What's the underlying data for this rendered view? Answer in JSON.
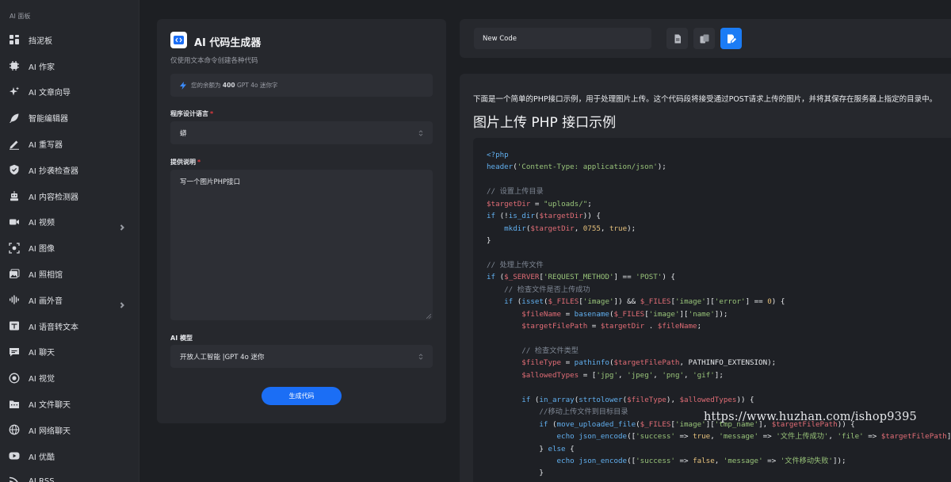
{
  "sidebar": {
    "section_label": "AI 面板",
    "items": [
      {
        "label": "挡泥板",
        "icon": "dashboard-icon"
      },
      {
        "label": "AI 作家",
        "icon": "chip-icon"
      },
      {
        "label": "AI 文章向导",
        "icon": "sparkle-icon"
      },
      {
        "label": "智能编辑器",
        "icon": "feather-icon"
      },
      {
        "label": "AI 重写器",
        "icon": "pencil-icon"
      },
      {
        "label": "AI 抄袭检查器",
        "icon": "shield-check-icon"
      },
      {
        "label": "AI 内容检测器",
        "icon": "robot-icon"
      },
      {
        "label": "AI 视频",
        "icon": "video-icon",
        "expandable": true
      },
      {
        "label": "AI 图像",
        "icon": "image-scan-icon"
      },
      {
        "label": "AI 照相馆",
        "icon": "photo-gallery-icon"
      },
      {
        "label": "AI 画外音",
        "icon": "audio-wave-icon",
        "expandable": true
      },
      {
        "label": "AI 语音转文本",
        "icon": "speech-text-icon"
      },
      {
        "label": "AI 聊天",
        "icon": "chat-icon"
      },
      {
        "label": "AI 视觉",
        "icon": "vision-icon"
      },
      {
        "label": "AI 文件聊天",
        "icon": "folder-chat-icon"
      },
      {
        "label": "AI 网络聊天",
        "icon": "globe-icon"
      },
      {
        "label": "AI 优酷",
        "icon": "youtube-icon"
      },
      {
        "label": "AI RSS",
        "icon": "rss-icon"
      }
    ]
  },
  "form": {
    "title": "AI 代码生成器",
    "subtitle": "仅使用文本命令创建各种代码",
    "balance_prefix": "您的余额为",
    "balance_amount": "400",
    "balance_suffix": "GPT 4o 迷你字",
    "language_label": "程序设计语言",
    "language_value": "蟒",
    "description_label": "提供说明",
    "description_value": "写一个图片PHP接口",
    "model_label": "AI 模型",
    "model_value": "开放人工智能 |GPT 4o 迷你",
    "submit_label": "生成代码"
  },
  "toolbar": {
    "document_name": "New Code"
  },
  "output": {
    "intro": "下面是一个简单的PHP接口示例，用于处理图片上传。这个代码段将接受通过POST请求上传的图片，并将其保存在服务器上指定的目录中。",
    "heading": "图片上传 PHP 接口示例",
    "code_lines": [
      [
        [
          "kw",
          "<?php"
        ]
      ],
      [
        [
          "kw",
          "header"
        ],
        [
          "pl",
          "("
        ],
        [
          "str",
          "'Content-Type: application/json'"
        ],
        [
          "pl",
          ");"
        ]
      ],
      [],
      [
        [
          "com",
          "// 设置上传目录"
        ]
      ],
      [
        [
          "var",
          "$targetDir"
        ],
        [
          "pl",
          " = "
        ],
        [
          "str",
          "\"uploads/\""
        ],
        [
          "pl",
          ";"
        ]
      ],
      [
        [
          "kw",
          "if"
        ],
        [
          "pl",
          " (!"
        ],
        [
          "kw",
          "is_dir"
        ],
        [
          "pl",
          "("
        ],
        [
          "var",
          "$targetDir"
        ],
        [
          "pl",
          ")) {"
        ]
      ],
      [
        [
          "pl",
          "    "
        ],
        [
          "kw",
          "mkdir"
        ],
        [
          "pl",
          "("
        ],
        [
          "var",
          "$targetDir"
        ],
        [
          "pl",
          ", "
        ],
        [
          "num",
          "0755"
        ],
        [
          "pl",
          ", "
        ],
        [
          "num",
          "true"
        ],
        [
          "pl",
          ");"
        ]
      ],
      [
        [
          "pl",
          "}"
        ]
      ],
      [],
      [
        [
          "com",
          "// 处理上传文件"
        ]
      ],
      [
        [
          "kw",
          "if"
        ],
        [
          "pl",
          " ("
        ],
        [
          "var",
          "$_SERVER"
        ],
        [
          "pl",
          "["
        ],
        [
          "str",
          "'REQUEST_METHOD'"
        ],
        [
          "pl",
          "] == "
        ],
        [
          "str",
          "'POST'"
        ],
        [
          "pl",
          ") {"
        ]
      ],
      [
        [
          "pl",
          "    "
        ],
        [
          "com",
          "// 检查文件是否上传成功"
        ]
      ],
      [
        [
          "pl",
          "    "
        ],
        [
          "kw",
          "if"
        ],
        [
          "pl",
          " ("
        ],
        [
          "kw",
          "isset"
        ],
        [
          "pl",
          "("
        ],
        [
          "var",
          "$_FILES"
        ],
        [
          "pl",
          "["
        ],
        [
          "str",
          "'image'"
        ],
        [
          "pl",
          "]) && "
        ],
        [
          "var",
          "$_FILES"
        ],
        [
          "pl",
          "["
        ],
        [
          "str",
          "'image'"
        ],
        [
          "pl",
          "]["
        ],
        [
          "str",
          "'error'"
        ],
        [
          "pl",
          "] == "
        ],
        [
          "num",
          "0"
        ],
        [
          "pl",
          ") {"
        ]
      ],
      [
        [
          "pl",
          "        "
        ],
        [
          "var",
          "$fileName"
        ],
        [
          "pl",
          " = "
        ],
        [
          "kw",
          "basename"
        ],
        [
          "pl",
          "("
        ],
        [
          "var",
          "$_FILES"
        ],
        [
          "pl",
          "["
        ],
        [
          "str",
          "'image'"
        ],
        [
          "pl",
          "]["
        ],
        [
          "str",
          "'name'"
        ],
        [
          "pl",
          "]);"
        ]
      ],
      [
        [
          "pl",
          "        "
        ],
        [
          "var",
          "$targetFilePath"
        ],
        [
          "pl",
          " = "
        ],
        [
          "var",
          "$targetDir"
        ],
        [
          "pl",
          " . "
        ],
        [
          "var",
          "$fileName"
        ],
        [
          "pl",
          ";"
        ]
      ],
      [],
      [
        [
          "pl",
          "        "
        ],
        [
          "com",
          "// 检查文件类型"
        ]
      ],
      [
        [
          "pl",
          "        "
        ],
        [
          "var",
          "$fileType"
        ],
        [
          "pl",
          " = "
        ],
        [
          "kw",
          "pathinfo"
        ],
        [
          "pl",
          "("
        ],
        [
          "var",
          "$targetFilePath"
        ],
        [
          "pl",
          ", PATHINFO_EXTENSION);"
        ]
      ],
      [
        [
          "pl",
          "        "
        ],
        [
          "var",
          "$allowedTypes"
        ],
        [
          "pl",
          " = ["
        ],
        [
          "str",
          "'jpg'"
        ],
        [
          "pl",
          ", "
        ],
        [
          "str",
          "'jpeg'"
        ],
        [
          "pl",
          ", "
        ],
        [
          "str",
          "'png'"
        ],
        [
          "pl",
          ", "
        ],
        [
          "str",
          "'gif'"
        ],
        [
          "pl",
          "];"
        ]
      ],
      [],
      [
        [
          "pl",
          "        "
        ],
        [
          "kw",
          "if"
        ],
        [
          "pl",
          " ("
        ],
        [
          "kw",
          "in_array"
        ],
        [
          "pl",
          "("
        ],
        [
          "kw",
          "strtolower"
        ],
        [
          "pl",
          "("
        ],
        [
          "var",
          "$fileType"
        ],
        [
          "pl",
          "), "
        ],
        [
          "var",
          "$allowedTypes"
        ],
        [
          "pl",
          ")) {"
        ]
      ],
      [
        [
          "pl",
          "            "
        ],
        [
          "com",
          "//移动上传文件到目标目录"
        ]
      ],
      [
        [
          "pl",
          "            "
        ],
        [
          "kw",
          "if"
        ],
        [
          "pl",
          " ("
        ],
        [
          "kw",
          "move_uploaded_file"
        ],
        [
          "pl",
          "("
        ],
        [
          "var",
          "$_FILES"
        ],
        [
          "pl",
          "["
        ],
        [
          "str",
          "'image'"
        ],
        [
          "pl",
          "]["
        ],
        [
          "str",
          "'tmp_name'"
        ],
        [
          "pl",
          "], "
        ],
        [
          "var",
          "$targetFilePath"
        ],
        [
          "pl",
          ")) {"
        ]
      ],
      [
        [
          "pl",
          "                "
        ],
        [
          "kw",
          "echo"
        ],
        [
          "pl",
          " "
        ],
        [
          "kw",
          "json_encode"
        ],
        [
          "pl",
          "(["
        ],
        [
          "str",
          "'success'"
        ],
        [
          "pl",
          " => "
        ],
        [
          "num",
          "true"
        ],
        [
          "pl",
          ", "
        ],
        [
          "str",
          "'message'"
        ],
        [
          "pl",
          " => "
        ],
        [
          "str",
          "'文件上传成功'"
        ],
        [
          "pl",
          ", "
        ],
        [
          "str",
          "'file'"
        ],
        [
          "pl",
          " => "
        ],
        [
          "var",
          "$targetFilePath"
        ],
        [
          "pl",
          "]);"
        ]
      ],
      [
        [
          "pl",
          "            } "
        ],
        [
          "kw",
          "else"
        ],
        [
          "pl",
          " {"
        ]
      ],
      [
        [
          "pl",
          "                "
        ],
        [
          "kw",
          "echo"
        ],
        [
          "pl",
          " "
        ],
        [
          "kw",
          "json_encode"
        ],
        [
          "pl",
          "(["
        ],
        [
          "str",
          "'success'"
        ],
        [
          "pl",
          " => "
        ],
        [
          "num",
          "false"
        ],
        [
          "pl",
          ", "
        ],
        [
          "str",
          "'message'"
        ],
        [
          "pl",
          " => "
        ],
        [
          "str",
          "'文件移动失败'"
        ],
        [
          "pl",
          "]);"
        ]
      ],
      [
        [
          "pl",
          "            }"
        ]
      ]
    ]
  },
  "watermark": "https://www.huzhan.com/ishop9395",
  "colors": {
    "accent": "#1b6ef5",
    "required": "#e0393e",
    "background": "#1d1f23",
    "panel": "#26282d"
  }
}
